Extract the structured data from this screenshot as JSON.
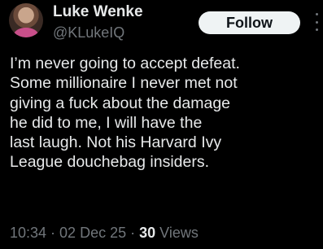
{
  "user": {
    "name": "Luke Wenke",
    "handle": "@KLukeIQ"
  },
  "follow_label": "Follow",
  "tweet": {
    "lines": [
      "I’m never going to accept defeat.",
      "Some millionaire I never met not",
      "giving a fuck about the damage",
      "he did to me, I will have the",
      "last laugh.  Not his Harvard Ivy",
      "League douchebag insiders."
    ]
  },
  "meta": {
    "time": "10:34",
    "sep1": " · ",
    "date": "02 Dec 25",
    "sep2": " · ",
    "views_count": "30",
    "views_label": " Views"
  },
  "icons": {
    "avatar": "user-avatar",
    "more": "more-options-icon"
  },
  "colors": {
    "background": "#000000",
    "text_primary": "#e7e9ea",
    "text_secondary": "#71767b",
    "follow_bg": "#eff3f4",
    "follow_text": "#0f1419"
  }
}
